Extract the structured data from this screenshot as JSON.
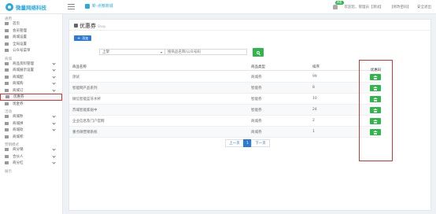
{
  "header": {
    "logo_text": "微量网络科技",
    "quick_link": "新·点微商城",
    "notify_badge": "消息",
    "welcome": "欢迎您，管理员【测试】",
    "account": "【修改密码】",
    "logout": "安全退出"
  },
  "sidebar": {
    "sections": [
      {
        "title": "通用",
        "items": [
          {
            "label": "首页",
            "chevron": false,
            "active": false
          },
          {
            "label": "会员管理",
            "chevron": false,
            "active": false
          },
          {
            "label": "商城设置",
            "chevron": false,
            "active": false
          },
          {
            "label": "全局设置",
            "chevron": false,
            "active": false
          },
          {
            "label": "公众号菜单",
            "chevron": false,
            "active": false
          }
        ]
      },
      {
        "title": "商城",
        "items": [
          {
            "label": "商品资料管理",
            "chevron": true,
            "active": false
          },
          {
            "label": "商城展示设置",
            "chevron": true,
            "active": false
          },
          {
            "label": "商城配",
            "chevron": true,
            "active": false
          },
          {
            "label": "商城购",
            "chevron": true,
            "active": false
          },
          {
            "label": "商城订",
            "chevron": true,
            "active": false
          },
          {
            "label": "优惠券",
            "chevron": false,
            "active": true
          },
          {
            "label": "现金券",
            "chevron": false,
            "active": false
          }
        ]
      },
      {
        "title": "活动",
        "items": [
          {
            "label": "商城秒",
            "chevron": true,
            "active": false
          },
          {
            "label": "商城拼",
            "chevron": true,
            "active": false
          },
          {
            "label": "商城砍",
            "chevron": true,
            "active": false
          },
          {
            "label": "商城积",
            "chevron": false,
            "active": false
          }
        ]
      },
      {
        "title": "营销模式",
        "items": [
          {
            "label": "商分销",
            "chevron": true,
            "active": false
          },
          {
            "label": "合伙人",
            "chevron": true,
            "active": false
          },
          {
            "label": "商分红",
            "chevron": true,
            "active": false
          }
        ]
      },
      {
        "title": "展示",
        "items": []
      }
    ]
  },
  "panel": {
    "title": "优惠券",
    "subtitle": "Shop",
    "add_button": "添加",
    "filter_select": "上架",
    "search_placeholder": "搜商品名称/公众号码",
    "columns": [
      "商品名称",
      "商品类型",
      "排序"
    ],
    "collect_header": "优惠码",
    "rows": [
      {
        "name": "测试",
        "type": "商城券",
        "sort": "99"
      },
      {
        "name": "智能网产品系列",
        "type": "智能券",
        "sort": "8"
      },
      {
        "name": "微信智能蓝牙水杯",
        "type": "智能券",
        "sort": "10"
      },
      {
        "name": "苏城智能家居中",
        "type": "智能券",
        "sort": "24"
      },
      {
        "name": "企业信息及门户官网",
        "type": "商城券",
        "sort": "2"
      },
      {
        "name": "重点微营销系统",
        "type": "商城券",
        "sort": "1"
      }
    ],
    "pagination": {
      "prev": "上一页",
      "current": "1",
      "next": "下一页"
    }
  },
  "colors": {
    "accent": "#2b7bd6",
    "success": "#2fb54a",
    "highlight": "#d9332e"
  }
}
